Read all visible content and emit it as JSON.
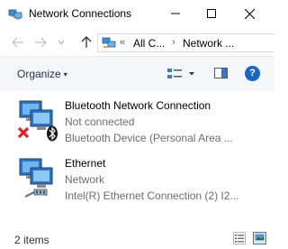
{
  "window": {
    "title": "Network Connections",
    "icon": "network-connections-icon",
    "controls": [
      "minimize-icon",
      "maximize-icon",
      "close-icon"
    ]
  },
  "navigation": {
    "back": "back-arrow-icon",
    "forward": "forward-arrow-icon",
    "recent": "chevron-down-icon",
    "up": "up-arrow-icon",
    "breadcrumb_overflow": "«",
    "breadcrumb": [
      "All C...",
      "Network ..."
    ]
  },
  "toolbar": {
    "organize_label": "Organize",
    "organize_caret": "▾",
    "change_view": "change-view-icon",
    "preview_pane": "preview-pane-icon",
    "help_label": "?"
  },
  "connections": [
    {
      "name": "Bluetooth Network Connection",
      "status": "Not connected",
      "device": "Bluetooth Device (Personal Area ...",
      "icon": "bluetooth-adapter-icon",
      "badges": [
        "red-x-icon",
        "bluetooth-icon"
      ]
    },
    {
      "name": "Ethernet",
      "status": "Network",
      "device": "Intel(R) Ethernet Connection (2) I2...",
      "icon": "ethernet-adapter-icon",
      "badges": [
        "network-cable-icon"
      ]
    }
  ],
  "status_bar": {
    "item_count": "2 items",
    "view_buttons": [
      "details-view-icon",
      "large-icons-view-icon"
    ]
  },
  "colors": {
    "help_button": "#1a66c7",
    "command_bar": "#f5f6f7",
    "secondary_text": "#6d6d6d",
    "error_x": "#d9262b"
  }
}
